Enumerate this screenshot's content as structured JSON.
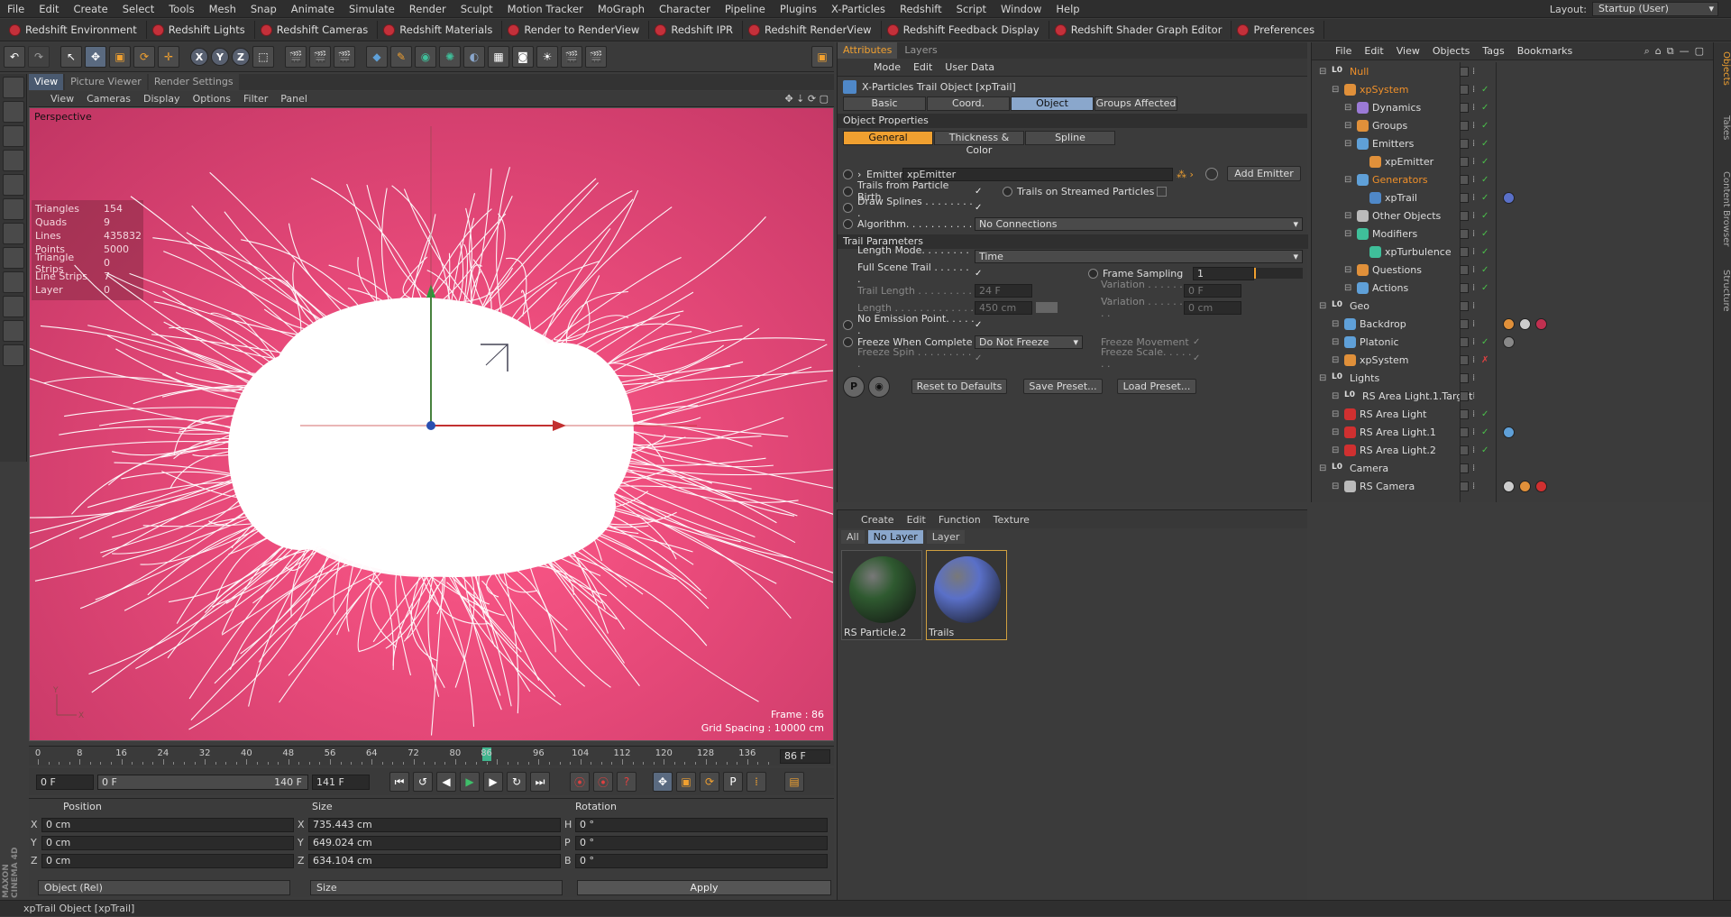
{
  "menubar": {
    "items": [
      "File",
      "Edit",
      "Create",
      "Select",
      "Tools",
      "Mesh",
      "Snap",
      "Animate",
      "Simulate",
      "Render",
      "Sculpt",
      "Motion Tracker",
      "MoGraph",
      "Character",
      "Pipeline",
      "Plugins",
      "X-Particles",
      "Redshift",
      "Script",
      "Window",
      "Help"
    ],
    "layout_label": "Layout:",
    "layout_value": "Startup (User)"
  },
  "redshift_bar": [
    "Redshift Environment",
    "Redshift Lights",
    "Redshift Cameras",
    "Redshift Materials",
    "Render to RenderView",
    "Redshift IPR",
    "Redshift RenderView",
    "Redshift Feedback Display",
    "Redshift Shader Graph Editor",
    "Preferences"
  ],
  "viewport": {
    "tabs": [
      "View",
      "Picture Viewer",
      "Render Settings"
    ],
    "menu": [
      "View",
      "Cameras",
      "Display",
      "Options",
      "Filter",
      "Panel"
    ],
    "label": "Perspective",
    "stats": [
      {
        "k": "Triangles",
        "v": "154"
      },
      {
        "k": "Quads",
        "v": "9"
      },
      {
        "k": "Lines",
        "v": "435832"
      },
      {
        "k": "Points",
        "v": "5000"
      },
      {
        "k": "Triangle Strips",
        "v": "0"
      },
      {
        "k": "Line Strips",
        "v": "7"
      },
      {
        "k": "Layer",
        "v": "0"
      }
    ],
    "frame": "Frame : 86",
    "grid": "Grid Spacing : 10000 cm",
    "axis_y": "Y",
    "axis_x": "X"
  },
  "timeline": {
    "ticks": [
      "0",
      "8",
      "16",
      "24",
      "32",
      "40",
      "48",
      "56",
      "64",
      "72",
      "80",
      "86",
      "96",
      "104",
      "112",
      "120",
      "128",
      "136"
    ],
    "current": 86,
    "max": 140,
    "frame_field": "86 F"
  },
  "playbar": {
    "start": "0 F",
    "range_start": "0 F",
    "range_end": "140 F",
    "end": "141 F"
  },
  "coords": {
    "headers": [
      "Position",
      "Size",
      "Rotation"
    ],
    "position": [
      {
        "ax": "X",
        "v": "0 cm"
      },
      {
        "ax": "Y",
        "v": "0 cm"
      },
      {
        "ax": "Z",
        "v": "0 cm"
      }
    ],
    "size": [
      {
        "ax": "X",
        "v": "735.443 cm"
      },
      {
        "ax": "Y",
        "v": "649.024 cm"
      },
      {
        "ax": "Z",
        "v": "634.104 cm"
      }
    ],
    "rotation": [
      {
        "ax": "H",
        "v": "0 °"
      },
      {
        "ax": "P",
        "v": "0 °"
      },
      {
        "ax": "B",
        "v": "0 °"
      }
    ],
    "mode": "Object (Rel)",
    "size_mode": "Size",
    "apply": "Apply"
  },
  "status": "xpTrail Object [xpTrail]",
  "attributes": {
    "tabs": [
      "Attributes",
      "Layers"
    ],
    "menu": [
      "Mode",
      "Edit",
      "User Data"
    ],
    "object_title": "X-Particles Trail Object [xpTrail]",
    "tabs2": [
      "Basic",
      "Coord.",
      "Object",
      "Groups Affected"
    ],
    "section_props": "Object Properties",
    "tabs3": [
      "General",
      "Thickness & Color",
      "Spline"
    ],
    "emitter_label": "Emitter",
    "emitter_value": "xpEmitter",
    "add_emitter": "Add Emitter",
    "trails_birth": "Trails from Particle Birth",
    "trails_streamed": "Trails on Streamed Particles",
    "draw_splines": "Draw Splines . . . . . . . . .",
    "algorithm_label": "Algorithm. . . . . . . . . . .",
    "algorithm_value": "No Connections",
    "section_trail": "Trail Parameters",
    "length_mode_label": "Length Mode. . . . . . . . .",
    "length_mode_value": "Time",
    "full_scene_label": "Full Scene Trail . . . . . . .",
    "frame_sampling_label": "Frame Sampling",
    "frame_sampling_value": "1",
    "trail_length_label": "Trail Length . . . . . . . . .",
    "trail_length_value": "24 F",
    "variation_label": "Variation . . . . . . . .",
    "variation1_value": "0 F",
    "length_label": "Length . . . . . . . . . . . . .",
    "length_value": "450 cm",
    "variation2_value": "0 cm",
    "no_emission_label": "No Emission Point. . . . . .",
    "freeze_complete_label": "Freeze When Complete",
    "freeze_complete_value": "Do Not Freeze",
    "freeze_movement_label": "Freeze Movement",
    "freeze_spin_label": "Freeze Spin . . . . . . . . . .",
    "freeze_scale_label": "Freeze Scale. . . . . . .",
    "reset": "Reset to Defaults",
    "save_preset": "Save Preset...",
    "load_preset": "Load Preset..."
  },
  "materials": {
    "menu": [
      "Create",
      "Edit",
      "Function",
      "Texture"
    ],
    "tabs": [
      "All",
      "No Layer",
      "Layer"
    ],
    "items": [
      {
        "name": "RS Particle.2",
        "color": "#2f5a30"
      },
      {
        "name": "Trails",
        "color": "#5a70c8"
      }
    ]
  },
  "objects": {
    "menu": [
      "File",
      "Edit",
      "View",
      "Objects",
      "Tags",
      "Bookmarks"
    ],
    "rows": [
      {
        "name": "Null",
        "indent": 0,
        "icon": "null",
        "color": "#bbbbbb",
        "orange": true,
        "check": "",
        "tags": []
      },
      {
        "name": "xpSystem",
        "indent": 1,
        "icon": "system",
        "color": "#e0903a",
        "orange": true,
        "check": "✓",
        "tags": []
      },
      {
        "name": "Dynamics",
        "indent": 2,
        "icon": "folder",
        "color": "#9b7ad6",
        "orange": false,
        "check": "✓",
        "tags": []
      },
      {
        "name": "Groups",
        "indent": 2,
        "icon": "folder",
        "color": "#e0903a",
        "orange": false,
        "check": "✓",
        "tags": []
      },
      {
        "name": "Emitters",
        "indent": 2,
        "icon": "folder",
        "color": "#5fa0d8",
        "orange": false,
        "check": "✓",
        "tags": []
      },
      {
        "name": "xpEmitter",
        "indent": 3,
        "icon": "emitter",
        "color": "#e0903a",
        "orange": false,
        "check": "✓",
        "tags": []
      },
      {
        "name": "Generators",
        "indent": 2,
        "icon": "folder",
        "color": "#5fa0d8",
        "orange": true,
        "check": "✓",
        "tags": []
      },
      {
        "name": "xpTrail",
        "indent": 3,
        "icon": "trail",
        "color": "#4f88c8",
        "orange": false,
        "check": "✓",
        "tags": [
          "#5a70c8"
        ]
      },
      {
        "name": "Other Objects",
        "indent": 2,
        "icon": "folder",
        "color": "#bbbbbb",
        "orange": false,
        "check": "✓",
        "tags": []
      },
      {
        "name": "Modifiers",
        "indent": 2,
        "icon": "folder",
        "color": "#3fbf9a",
        "orange": false,
        "check": "✓",
        "tags": []
      },
      {
        "name": "xpTurbulence",
        "indent": 3,
        "icon": "mod",
        "color": "#3fbf9a",
        "orange": false,
        "check": "✓",
        "tags": []
      },
      {
        "name": "Questions",
        "indent": 2,
        "icon": "folder",
        "color": "#e0903a",
        "orange": false,
        "check": "✓",
        "tags": []
      },
      {
        "name": "Actions",
        "indent": 2,
        "icon": "folder",
        "color": "#5fa0d8",
        "orange": false,
        "check": "✓",
        "tags": []
      },
      {
        "name": "Geo",
        "indent": 0,
        "icon": "null",
        "color": "#bbbbbb",
        "orange": false,
        "check": "",
        "tags": []
      },
      {
        "name": "Backdrop",
        "indent": 1,
        "icon": "geo",
        "color": "#5fa0d8",
        "orange": false,
        "check": "",
        "tags": [
          "#e0903a",
          "#cccccc",
          "#c03050"
        ]
      },
      {
        "name": "Platonic",
        "indent": 1,
        "icon": "geo",
        "color": "#5fa0d8",
        "orange": false,
        "check": "✓",
        "tags": [
          "#888888"
        ]
      },
      {
        "name": "xpSystem",
        "indent": 1,
        "icon": "system",
        "color": "#e0903a",
        "orange": false,
        "check": "✗",
        "tags": []
      },
      {
        "name": "Lights",
        "indent": 0,
        "icon": "null",
        "color": "#bbbbbb",
        "orange": false,
        "check": "",
        "tags": []
      },
      {
        "name": "RS Area Light.1.Target",
        "indent": 1,
        "icon": "null",
        "color": "#bbbbbb",
        "orange": false,
        "check": "",
        "tags": []
      },
      {
        "name": "RS Area Light",
        "indent": 1,
        "icon": "light",
        "color": "#d03030",
        "orange": false,
        "check": "✓",
        "tags": []
      },
      {
        "name": "RS Area Light.1",
        "indent": 1,
        "icon": "light",
        "color": "#d03030",
        "orange": false,
        "check": "✓",
        "tags": [
          "#5fa0d8"
        ]
      },
      {
        "name": "RS Area Light.2",
        "indent": 1,
        "icon": "light",
        "color": "#d03030",
        "orange": false,
        "check": "✓",
        "tags": []
      },
      {
        "name": "Camera",
        "indent": 0,
        "icon": "null",
        "color": "#bbbbbb",
        "orange": false,
        "check": "",
        "tags": []
      },
      {
        "name": "RS Camera",
        "indent": 1,
        "icon": "camera",
        "color": "#bbbbbb",
        "orange": false,
        "check": "",
        "tags": [
          "#cccccc",
          "#e0903a",
          "#d03030"
        ]
      }
    ]
  },
  "side_tabs": [
    "Objects",
    "Takes",
    "Content Browser",
    "Structure"
  ],
  "brand": "MAXON CINEMA 4D"
}
